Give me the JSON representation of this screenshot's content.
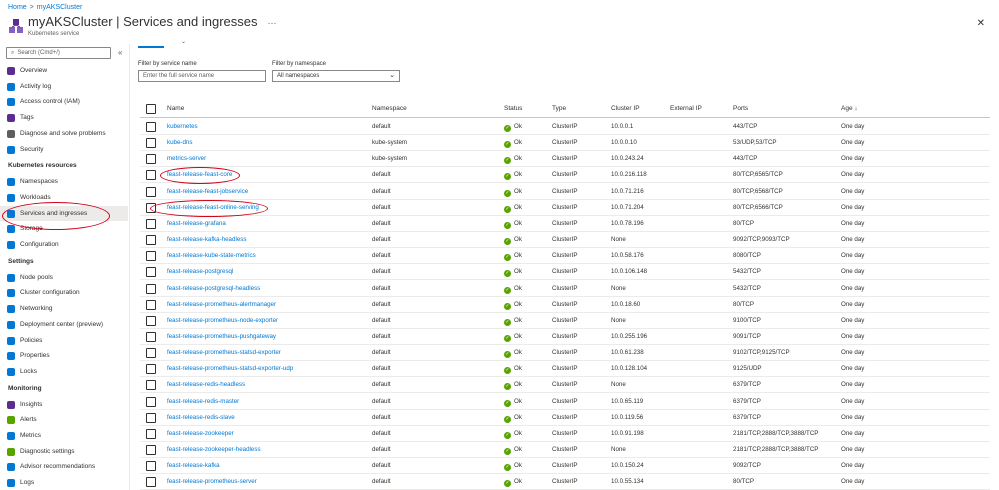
{
  "breadcrumb": {
    "home": "Home",
    "cluster": "myAKSCluster"
  },
  "header": {
    "title": "myAKSCluster | Services and ingresses",
    "subtitle": "Kubernetes service",
    "more": "···",
    "close": "✕"
  },
  "sidebar": {
    "search_placeholder": "Search (Cmd+/)",
    "collapse": "«",
    "items": [
      {
        "label": "Overview",
        "icon": "overview-icon",
        "color": "#5c2d91"
      },
      {
        "label": "Activity log",
        "icon": "activity-log-icon",
        "color": "#0078d4"
      },
      {
        "label": "Access control (IAM)",
        "icon": "iam-icon",
        "color": "#0078d4"
      },
      {
        "label": "Tags",
        "icon": "tag-icon",
        "color": "#5c2d91"
      },
      {
        "label": "Diagnose and solve problems",
        "icon": "wrench-icon",
        "color": "#605e5c"
      },
      {
        "label": "Security",
        "icon": "shield-icon",
        "color": "#0078d4"
      }
    ],
    "section_k8s": "Kubernetes resources",
    "k8s_items": [
      {
        "label": "Namespaces",
        "icon": "namespaces-icon",
        "color": "#0078d4"
      },
      {
        "label": "Workloads",
        "icon": "workloads-icon",
        "color": "#0078d4"
      },
      {
        "label": "Services and ingresses",
        "icon": "services-icon",
        "color": "#0078d4"
      },
      {
        "label": "Storage",
        "icon": "storage-icon",
        "color": "#0078d4"
      },
      {
        "label": "Configuration",
        "icon": "configuration-icon",
        "color": "#0078d4"
      }
    ],
    "section_settings": "Settings",
    "settings_items": [
      {
        "label": "Node pools",
        "icon": "node-pools-icon",
        "color": "#0078d4"
      },
      {
        "label": "Cluster configuration",
        "icon": "cluster-config-icon",
        "color": "#0078d4"
      },
      {
        "label": "Networking",
        "icon": "networking-icon",
        "color": "#0078d4"
      },
      {
        "label": "Deployment center (preview)",
        "icon": "deployment-center-icon",
        "color": "#0078d4"
      },
      {
        "label": "Policies",
        "icon": "policies-icon",
        "color": "#0078d4"
      },
      {
        "label": "Properties",
        "icon": "properties-icon",
        "color": "#0078d4"
      },
      {
        "label": "Locks",
        "icon": "lock-icon",
        "color": "#0078d4"
      }
    ],
    "section_monitoring": "Monitoring",
    "monitoring_items": [
      {
        "label": "Insights",
        "icon": "insights-icon",
        "color": "#5c2d91"
      },
      {
        "label": "Alerts",
        "icon": "alerts-icon",
        "color": "#57a300"
      },
      {
        "label": "Metrics",
        "icon": "metrics-icon",
        "color": "#0078d4"
      },
      {
        "label": "Diagnostic settings",
        "icon": "diagnostic-settings-icon",
        "color": "#57a300"
      },
      {
        "label": "Advisor recommendations",
        "icon": "advisor-icon",
        "color": "#0078d4"
      },
      {
        "label": "Logs",
        "icon": "logs-icon",
        "color": "#0078d4"
      }
    ]
  },
  "filters": {
    "service_label": "Filter by service name",
    "service_placeholder": "Enter the full service name",
    "namespace_label": "Filter by namespace",
    "namespace_value": "All namespaces",
    "chevron": "⌄"
  },
  "table": {
    "columns": [
      "Name",
      "Namespace",
      "Status",
      "Type",
      "Cluster IP",
      "External IP",
      "Ports",
      "Age ↓"
    ],
    "rows": [
      [
        "kubernetes",
        "default",
        "Ok",
        "ClusterIP",
        "10.0.0.1",
        "",
        "443/TCP",
        "One day"
      ],
      [
        "kube-dns",
        "kube-system",
        "Ok",
        "ClusterIP",
        "10.0.0.10",
        "",
        "53/UDP,53/TCP",
        "One day"
      ],
      [
        "metrics-server",
        "kube-system",
        "Ok",
        "ClusterIP",
        "10.0.243.24",
        "",
        "443/TCP",
        "One day"
      ],
      [
        "feast-release-feast-core",
        "default",
        "Ok",
        "ClusterIP",
        "10.0.216.118",
        "",
        "80/TCP,6565/TCP",
        "One day"
      ],
      [
        "feast-release-feast-jobservice",
        "default",
        "Ok",
        "ClusterIP",
        "10.0.71.216",
        "",
        "80/TCP,6568/TCP",
        "One day"
      ],
      [
        "feast-release-feast-online-serving",
        "default",
        "Ok",
        "ClusterIP",
        "10.0.71.204",
        "",
        "80/TCP,6566/TCP",
        "One day"
      ],
      [
        "feast-release-grafana",
        "default",
        "Ok",
        "ClusterIP",
        "10.0.78.196",
        "",
        "80/TCP",
        "One day"
      ],
      [
        "feast-release-kafka-headless",
        "default",
        "Ok",
        "ClusterIP",
        "None",
        "",
        "9092/TCP,9093/TCP",
        "One day"
      ],
      [
        "feast-release-kube-state-metrics",
        "default",
        "Ok",
        "ClusterIP",
        "10.0.58.176",
        "",
        "8080/TCP",
        "One day"
      ],
      [
        "feast-release-postgresql",
        "default",
        "Ok",
        "ClusterIP",
        "10.0.106.148",
        "",
        "5432/TCP",
        "One day"
      ],
      [
        "feast-release-postgresql-headless",
        "default",
        "Ok",
        "ClusterIP",
        "None",
        "",
        "5432/TCP",
        "One day"
      ],
      [
        "feast-release-prometheus-alertmanager",
        "default",
        "Ok",
        "ClusterIP",
        "10.0.18.60",
        "",
        "80/TCP",
        "One day"
      ],
      [
        "feast-release-prometheus-node-exporter",
        "default",
        "Ok",
        "ClusterIP",
        "None",
        "",
        "9100/TCP",
        "One day"
      ],
      [
        "feast-release-prometheus-pushgateway",
        "default",
        "Ok",
        "ClusterIP",
        "10.0.255.196",
        "",
        "9091/TCP",
        "One day"
      ],
      [
        "feast-release-prometheus-statsd-exporter",
        "default",
        "Ok",
        "ClusterIP",
        "10.0.61.238",
        "",
        "9102/TCP,9125/TCP",
        "One day"
      ],
      [
        "feast-release-prometheus-statsd-exporter-udp",
        "default",
        "Ok",
        "ClusterIP",
        "10.0.128.104",
        "",
        "9125/UDP",
        "One day"
      ],
      [
        "feast-release-redis-headless",
        "default",
        "Ok",
        "ClusterIP",
        "None",
        "",
        "6379/TCP",
        "One day"
      ],
      [
        "feast-release-redis-master",
        "default",
        "Ok",
        "ClusterIP",
        "10.0.65.119",
        "",
        "6379/TCP",
        "One day"
      ],
      [
        "feast-release-redis-slave",
        "default",
        "Ok",
        "ClusterIP",
        "10.0.119.56",
        "",
        "6379/TCP",
        "One day"
      ],
      [
        "feast-release-zookeeper",
        "default",
        "Ok",
        "ClusterIP",
        "10.0.91.198",
        "",
        "2181/TCP,2888/TCP,3888/TCP",
        "One day"
      ],
      [
        "feast-release-zookeeper-headless",
        "default",
        "Ok",
        "ClusterIP",
        "None",
        "",
        "2181/TCP,2888/TCP,3888/TCP",
        "One day"
      ],
      [
        "feast-release-kafka",
        "default",
        "Ok",
        "ClusterIP",
        "10.0.150.24",
        "",
        "9092/TCP",
        "One day"
      ],
      [
        "feast-release-prometheus-server",
        "default",
        "Ok",
        "ClusterIP",
        "10.0.55.134",
        "",
        "80/TCP",
        "One day"
      ]
    ]
  },
  "colors": {
    "accent": "#0078d4",
    "annotation": "#d0021b",
    "ok": "#57a300"
  }
}
